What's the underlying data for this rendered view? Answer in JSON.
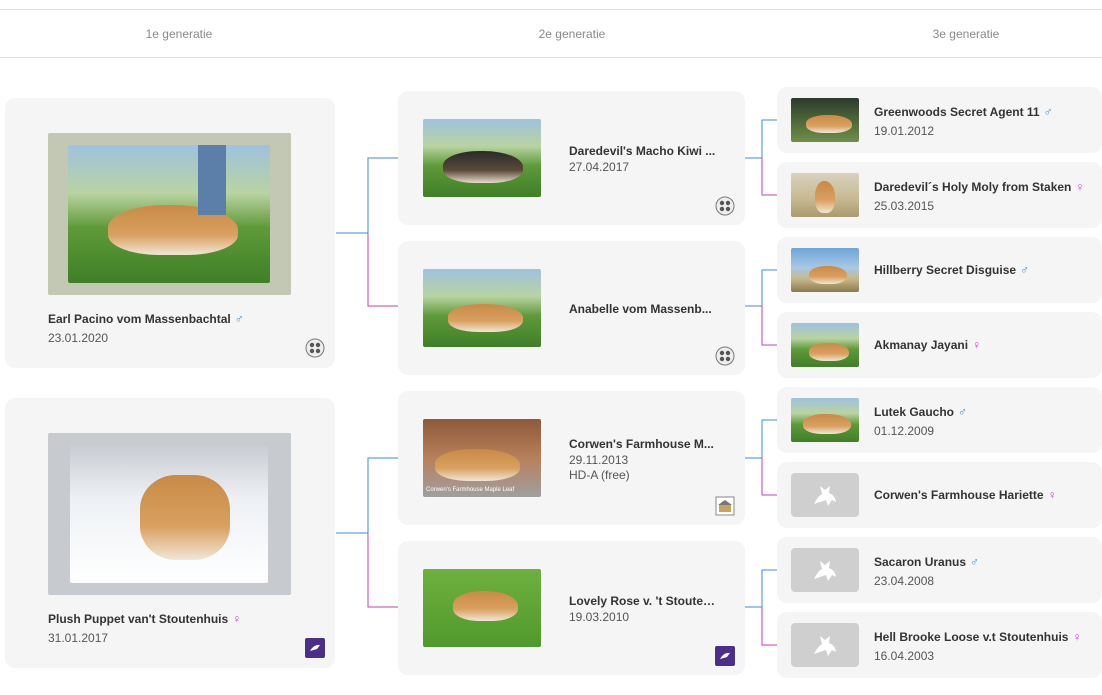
{
  "header": {
    "gen1": "1e generatie",
    "gen2": "2e generatie",
    "gen3": "3e generatie"
  },
  "colors": {
    "male": "#3b8fd6",
    "female": "#d03bd0",
    "card": "#f5f5f5",
    "line_male": "#3b8fd6",
    "line_female": "#c040c0"
  },
  "gen1": [
    {
      "name": "Earl Pacino vom Massenbachtal",
      "sex": "♂",
      "date": "23.01.2020",
      "badge": "club-logo-icon"
    },
    {
      "name": "Plush Puppet van't Stoutenhuis",
      "sex": "♀",
      "date": "31.01.2017",
      "badge": "breeder-logo-icon"
    }
  ],
  "gen2": [
    {
      "name": "Daredevil's Macho Kiwi ...",
      "date": "27.04.2017",
      "extra": "",
      "badge": "club-logo-icon"
    },
    {
      "name": "Anabelle vom Massenb...",
      "date": "",
      "extra": "",
      "badge": "club-logo-icon"
    },
    {
      "name": "Corwen's Farmhouse M...",
      "date": "29.11.2013",
      "extra": "HD-A (free)",
      "badge": "kennel-logo-icon",
      "caption": "Corwen's Farmhouse Maple Leaf"
    },
    {
      "name": "Lovely Rose v. 't Stouten...",
      "date": "19.03.2010",
      "extra": "",
      "badge": "breeder-logo-icon"
    }
  ],
  "gen3": [
    {
      "name": "Greenwoods Secret Agent 11",
      "sex": "♂",
      "date": "19.01.2012"
    },
    {
      "name": "Daredevil´s Holy Moly from Staken",
      "sex": "♀",
      "date": "25.03.2015"
    },
    {
      "name": "Hillberry Secret Disguise",
      "sex": "♂",
      "date": ""
    },
    {
      "name": "Akmanay Jayani",
      "sex": "♀",
      "date": ""
    },
    {
      "name": "Lutek Gaucho",
      "sex": "♂",
      "date": "01.12.2009"
    },
    {
      "name": "Corwen's Farmhouse Hariette",
      "sex": "♀",
      "date": ""
    },
    {
      "name": "Sacaron Uranus",
      "sex": "♂",
      "date": "23.04.2008"
    },
    {
      "name": "Hell Brooke Loose v.t Stoutenhuis",
      "sex": "♀",
      "date": "16.04.2003"
    }
  ]
}
